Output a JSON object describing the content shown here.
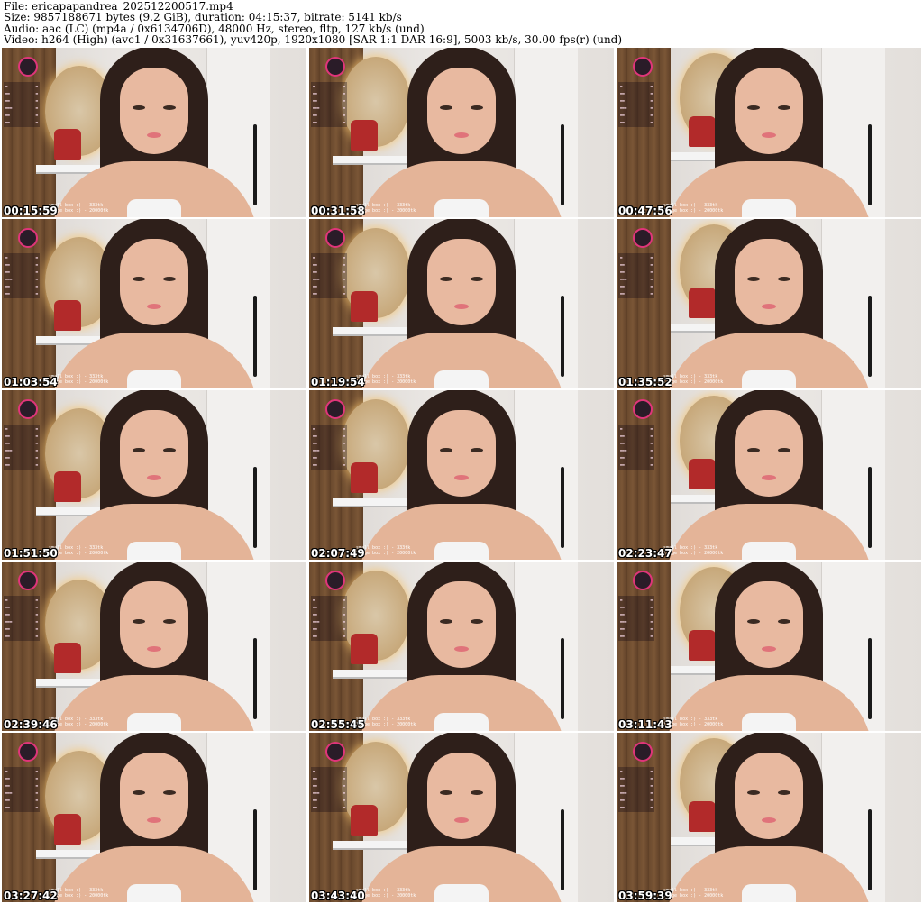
{
  "header": {
    "file_line": "File: ericapapandrea_202512200517.mp4",
    "size_line": "Size: 9857188671 bytes (9.2 GiB), duration: 04:15:37, bitrate: 5141 kb/s",
    "audio_line": "Audio: aac (LC) (mp4a / 0x6134706D), 48000 Hz, stereo, fltp, 127 kb/s (und)",
    "video_line": "Video: h264 (High) (avc1 / 0x31637661), yuv420p, 1920x1080 [SAR 1:1 DAR 16:9], 5003 kb/s, 30.00 fps(r) (und)"
  },
  "overlay": {
    "small_box": "small box :) - 333tk",
    "large_box": "large box :) - 20000tk"
  },
  "thumbnails": [
    {
      "timestamp": "00:15:59"
    },
    {
      "timestamp": "00:31:58"
    },
    {
      "timestamp": "00:47:56"
    },
    {
      "timestamp": "01:03:54"
    },
    {
      "timestamp": "01:19:54"
    },
    {
      "timestamp": "01:35:52"
    },
    {
      "timestamp": "01:51:50"
    },
    {
      "timestamp": "02:07:49"
    },
    {
      "timestamp": "02:23:47"
    },
    {
      "timestamp": "02:39:46"
    },
    {
      "timestamp": "02:55:45"
    },
    {
      "timestamp": "03:11:43"
    },
    {
      "timestamp": "03:27:42"
    },
    {
      "timestamp": "03:43:40"
    },
    {
      "timestamp": "03:59:39"
    }
  ]
}
